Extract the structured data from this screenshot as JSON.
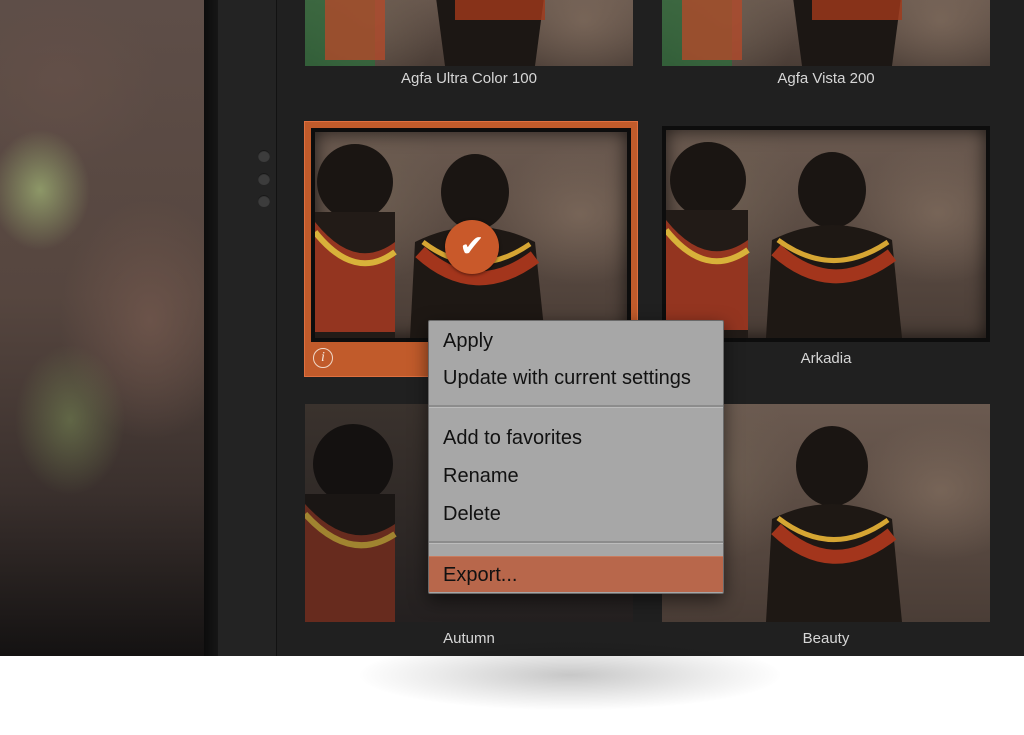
{
  "app": {
    "colors": {
      "accent": "#c15b2b",
      "menu_background": "#a7a7a7",
      "menu_highlight": "#b8674b",
      "grid_background": "#202020"
    }
  },
  "presets": [
    {
      "label": "Agfa Ultra Color 100",
      "selected": false
    },
    {
      "label": "Agfa Vista 200",
      "selected": false
    },
    {
      "label": "",
      "selected": true,
      "info_icon": "i",
      "badge": "✔"
    },
    {
      "label": "Arkadia",
      "selected": false
    },
    {
      "label": "Autumn",
      "selected": false
    },
    {
      "label": "Beauty",
      "selected": false
    }
  ],
  "context_menu": {
    "items": [
      "Apply",
      "Update with current settings",
      "Add to favorites",
      "Rename",
      "Delete",
      "Export..."
    ],
    "highlighted": "Export..."
  }
}
